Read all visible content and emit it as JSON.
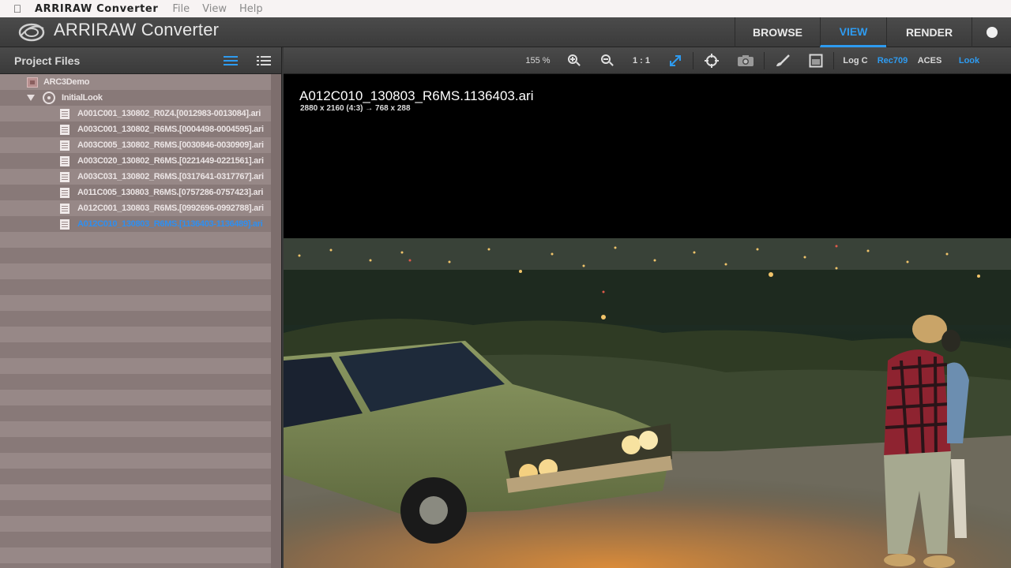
{
  "menubar": {
    "app_name": "ARRIRAW Converter",
    "menus": [
      "File",
      "View",
      "Help"
    ]
  },
  "header": {
    "title": "ARRIRAW Converter",
    "tabs": [
      "BROWSE",
      "VIEW",
      "RENDER"
    ],
    "active_tab": "VIEW"
  },
  "project_panel": {
    "title": "Project Files",
    "project": "ARC3Demo",
    "look": "InitialLook",
    "files": [
      "A001C001_130802_R0Z4.[0012983-0013084].ari",
      "A003C001_130802_R6MS.[0004498-0004595].ari",
      "A003C005_130802_R6MS.[0030846-0030909].ari",
      "A003C020_130802_R6MS.[0221449-0221561].ari",
      "A003C031_130802_R6MS.[0317641-0317767].ari",
      "A011C005_130803_R6MS.[0757286-0757423].ari",
      "A012C001_130803_R6MS.[0992696-0992788].ari",
      "A012C010_130803_R6MS.[1136403-1136489].ari"
    ],
    "selected_index": 7
  },
  "toolbar": {
    "zoom": "155 %",
    "one_to_one": "1 : 1",
    "log_c": "Log C",
    "rec709": "Rec709",
    "aces": "ACES",
    "look": "Look"
  },
  "viewer": {
    "file_name": "A012C010_130803_R6MS.1136403.ari",
    "resolution": "2880 x 2160 (4:3) → 768 x 288"
  },
  "colors": {
    "accent": "#2e9bf0",
    "panel_bg": "#8a7a79",
    "toolbar_bg": "#3f3f3f"
  }
}
